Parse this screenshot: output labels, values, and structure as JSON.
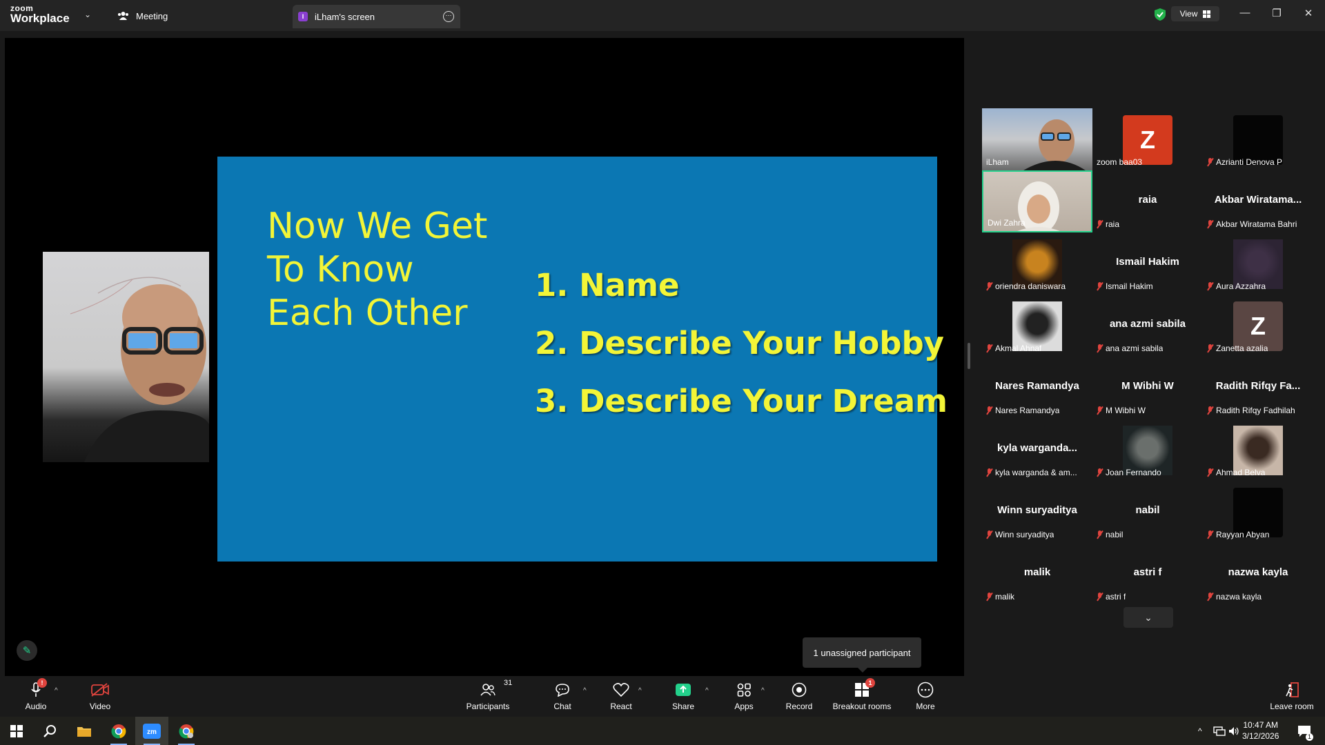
{
  "titlebar": {
    "logo_line1": "zoom",
    "logo_line2": "Workplace",
    "meeting_tab": "Meeting",
    "screen_tab_badge": "I",
    "screen_tab": "iLham's screen",
    "view_label": "View"
  },
  "slide": {
    "title_lines": [
      "Now We Get",
      "To Know",
      "Each Other"
    ],
    "items": [
      "1. Name",
      "2. Describe Your Hobby",
      "3. Describe Your Dream"
    ],
    "bg_color": "#0b77b3",
    "text_color": "#f3f537"
  },
  "gallery": [
    {
      "name": "iLham",
      "type": "video",
      "muted": false,
      "active": false
    },
    {
      "name": "zoom baa03",
      "type": "avatar",
      "letter": "Z",
      "color": "#d33a1e",
      "muted": false
    },
    {
      "name": "Azrianti Denova P",
      "type": "dark",
      "muted": true
    },
    {
      "name": "Dwi Zahra",
      "type": "video",
      "muted": false,
      "active": true
    },
    {
      "name": "raia",
      "type": "text",
      "display": "raia",
      "muted": true
    },
    {
      "name": "Akbar Wiratama Bahri",
      "type": "text",
      "display": "Akbar  Wiratama...",
      "muted": true
    },
    {
      "name": "oriendra daniswara",
      "type": "photo",
      "muted": true
    },
    {
      "name": "Ismail Hakim",
      "type": "text",
      "display": "Ismail Hakim",
      "muted": true
    },
    {
      "name": "Aura Azzahra",
      "type": "photo",
      "muted": true
    },
    {
      "name": "Akmal Ahnaf",
      "type": "photo",
      "muted": true
    },
    {
      "name": "ana azmi sabila",
      "type": "text",
      "display": "ana azmi sabila",
      "muted": true
    },
    {
      "name": "Zanetta azalia",
      "type": "avatar",
      "letter": "Z",
      "color": "#5a4643",
      "muted": true
    },
    {
      "name": "Nares Ramandya",
      "type": "text",
      "display": "Nares Ramandya",
      "muted": true
    },
    {
      "name": "M Wibhi W",
      "type": "text",
      "display": "M Wibhi W",
      "muted": true
    },
    {
      "name": "Radith Rifqy Fadhilah",
      "type": "text",
      "display": "Radith  Rifqy  Fa...",
      "muted": true
    },
    {
      "name": "kyla warganda & am...",
      "type": "text",
      "display": "kyla  warganda...",
      "muted": true
    },
    {
      "name": "Joan Fernando",
      "type": "photo",
      "muted": true
    },
    {
      "name": "Ahmad Belva",
      "type": "photo",
      "muted": true
    },
    {
      "name": "Winn suryaditya",
      "type": "text",
      "display": "Winn suryaditya",
      "muted": true
    },
    {
      "name": "nabil",
      "type": "text",
      "display": "nabil",
      "muted": true
    },
    {
      "name": "Rayyan Abyan",
      "type": "dark",
      "muted": true
    },
    {
      "name": "malik",
      "type": "text",
      "display": "malik",
      "muted": true
    },
    {
      "name": "astri f",
      "type": "text",
      "display": "astri f",
      "muted": true
    },
    {
      "name": "nazwa kayla",
      "type": "text",
      "display": "nazwa kayla",
      "muted": true
    }
  ],
  "tooltip": "1 unassigned participant",
  "toolbar": {
    "audio": "Audio",
    "video": "Video",
    "participants": "Participants",
    "participants_count": "31",
    "chat": "Chat",
    "react": "React",
    "share": "Share",
    "apps": "Apps",
    "record": "Record",
    "breakout": "Breakout rooms",
    "breakout_badge": "1",
    "audio_badge": "!",
    "more": "More",
    "leave": "Leave room"
  },
  "taskbar": {
    "time": "10:47 AM",
    "date": "3/12/2026",
    "notif_count": "1"
  }
}
